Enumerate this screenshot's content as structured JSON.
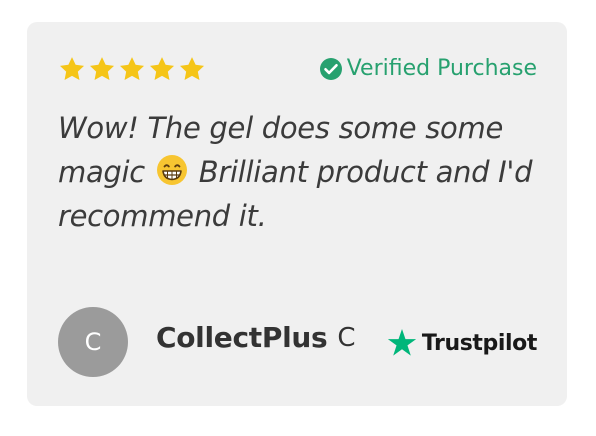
{
  "review": {
    "rating": 5,
    "max_rating": 5,
    "verified_label": "Verified Purchase",
    "text_part1": "Wow! The gel does some some magic",
    "emoji": "grinning-face",
    "text_part2": "Brilliant product and I'd recommend it."
  },
  "author": {
    "initial": "C",
    "name": "CollectPlus",
    "suffix": "C"
  },
  "brand": {
    "name": "Trustpilot"
  },
  "colors": {
    "card_bg": "#f0f0f0",
    "star": "#f5c518",
    "verified_green": "#27a16f",
    "trustpilot_green": "#00b67a",
    "avatar_bg": "#9b9b9b",
    "text": "#3b3b3b"
  }
}
